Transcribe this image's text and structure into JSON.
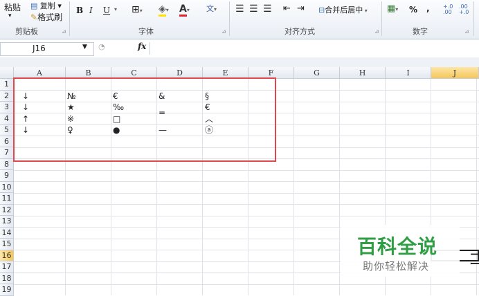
{
  "ribbon": {
    "paste_label": "粘贴",
    "copy_label": "复制",
    "format_painter_label": "格式刷",
    "clipboard_group": "剪贴板",
    "font_group": "字体",
    "align_group": "对齐方式",
    "number_group": "数字",
    "merge_label": "合并后居中",
    "bold": "B",
    "italic": "I",
    "underline": "U",
    "percent": "%",
    "comma": ",",
    "inc_decimal": "+.0 .00",
    "dec_decimal": ".00 +.0"
  },
  "formula_bar": {
    "name_box": "J16",
    "fx": "fx"
  },
  "columns": [
    "A",
    "B",
    "C",
    "D",
    "E",
    "F",
    "G",
    "H",
    "I",
    "J"
  ],
  "rows": [
    "1",
    "2",
    "3",
    "4",
    "5",
    "6",
    "7",
    "8",
    "9",
    "10",
    "11",
    "12",
    "13",
    "14",
    "15",
    "16",
    "17",
    "18",
    "19"
  ],
  "cells": {
    "A2": "↓",
    "B2": "№",
    "C2": "€",
    "D2": "&",
    "E2": "§",
    "A3": "↓",
    "B3": "★",
    "C3": "‰",
    "E3": "€",
    "A4": "↑",
    "B4": "※",
    "C4": "□",
    "D34": "=",
    "E4": "︿",
    "A5": "↓",
    "B5": "♀",
    "C5": "●",
    "D5": "—",
    "E5": "ⓐ"
  },
  "watermark": {
    "title": "百科全说",
    "subtitle": "助你轻松解决"
  },
  "colors": {
    "highlight_box": "#e0474c",
    "selected_header": "#f6c65a",
    "watermark_green": "#2f9e44"
  }
}
